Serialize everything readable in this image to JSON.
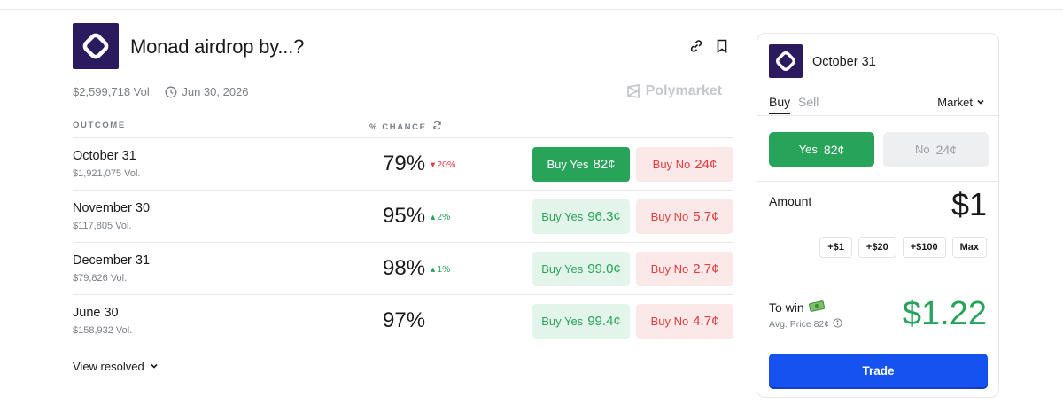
{
  "market": {
    "title": "Monad airdrop by...?",
    "volume": "$2,599,718 Vol.",
    "end_date": "Jun 30, 2026",
    "brand": "Polymarket",
    "column_outcome": "OUTCOME",
    "column_chance": "% CHANCE",
    "view_resolved": "View resolved",
    "outcomes": [
      {
        "label": "October 31",
        "volume": "$1,921,075 Vol.",
        "chance": "79%",
        "change": "20%",
        "change_dir": "down",
        "yes_label": "Buy Yes",
        "yes_price": "82¢",
        "no_label": "Buy No",
        "no_price": "24¢",
        "selected": true
      },
      {
        "label": "November 30",
        "volume": "$117,805 Vol.",
        "chance": "95%",
        "change": "2%",
        "change_dir": "up",
        "yes_label": "Buy Yes",
        "yes_price": "96.3¢",
        "no_label": "Buy No",
        "no_price": "5.7¢",
        "selected": false
      },
      {
        "label": "December 31",
        "volume": "$79,826 Vol.",
        "chance": "98%",
        "change": "1%",
        "change_dir": "up",
        "yes_label": "Buy Yes",
        "yes_price": "99.0¢",
        "no_label": "Buy No",
        "no_price": "2.7¢",
        "selected": false
      },
      {
        "label": "June 30",
        "volume": "$158,932 Vol.",
        "chance": "97%",
        "change": "",
        "change_dir": "none",
        "yes_label": "Buy Yes",
        "yes_price": "99.4¢",
        "no_label": "Buy No",
        "no_price": "4.7¢",
        "selected": false
      }
    ]
  },
  "trade": {
    "title": "October 31",
    "tab_buy": "Buy",
    "tab_sell": "Sell",
    "order_type": "Market",
    "yes_label": "Yes",
    "yes_price": "82¢",
    "no_label": "No",
    "no_price": "24¢",
    "amount_label": "Amount",
    "amount_value": "$1",
    "chips": [
      "+$1",
      "+$20",
      "+$100",
      "Max"
    ],
    "towin_label": "To win",
    "avg_price": "Avg. Price 82¢",
    "towin_value": "$1.22",
    "trade_button": "Trade"
  },
  "colors": {
    "green": "#27a35a",
    "red": "#e23b3b",
    "blue": "#1652f0",
    "logo_bg": "#2c1a5e"
  },
  "icons": {
    "link": "link-icon",
    "bookmark": "bookmark-icon",
    "clock": "clock-icon",
    "refresh": "refresh-icon",
    "chevron": "chevron-down-icon",
    "money": "money-icon",
    "info": "info-icon"
  }
}
